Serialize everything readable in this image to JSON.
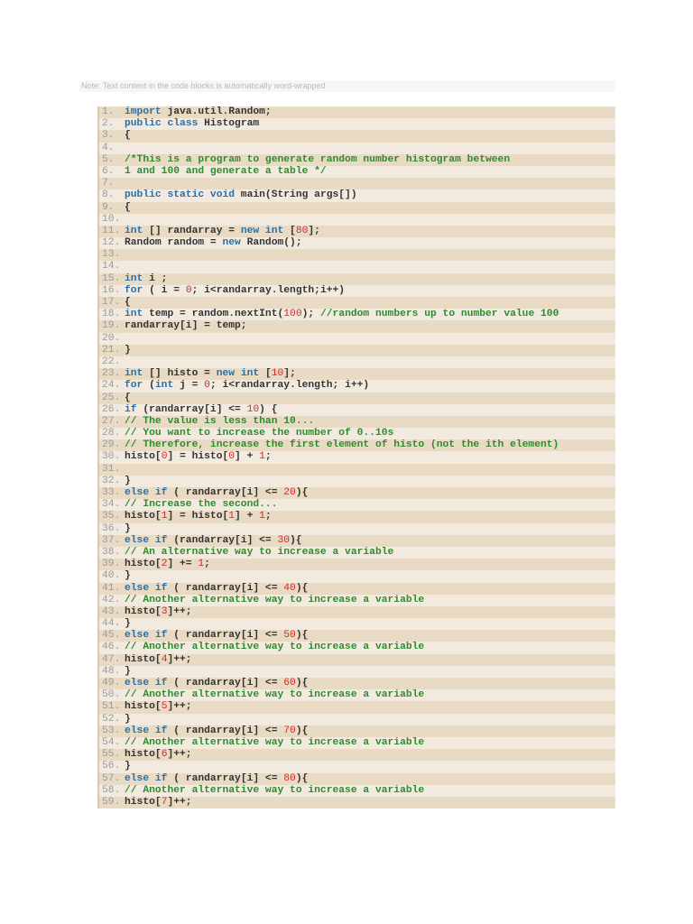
{
  "note": "Note: Text content in the code blocks is automatically word-wrapped",
  "colors": {
    "keyword": "#2a6fa8",
    "number": "#d42a2a",
    "comment": "#2e8b2e"
  },
  "lines": [
    [
      [
        "k",
        "import"
      ],
      [
        "t",
        " java.util.Random;"
      ]
    ],
    [
      [
        "k",
        "public class"
      ],
      [
        "t",
        " Histogram"
      ]
    ],
    [
      [
        "t",
        "{"
      ]
    ],
    [],
    [
      [
        "c",
        "/*This is a program to generate random number histogram between"
      ]
    ],
    [
      [
        "c",
        "1 and 100 and generate a table */"
      ]
    ],
    [],
    [
      [
        "k",
        "public static void"
      ],
      [
        "t",
        " main(String args[])"
      ]
    ],
    [
      [
        "t",
        "{"
      ]
    ],
    [],
    [
      [
        "k",
        "int"
      ],
      [
        "t",
        " [] randarray = "
      ],
      [
        "k",
        "new int"
      ],
      [
        "t",
        " ["
      ],
      [
        "n",
        "80"
      ],
      [
        "t",
        "];"
      ]
    ],
    [
      [
        "t",
        "Random random = "
      ],
      [
        "k",
        "new"
      ],
      [
        "t",
        " Random();"
      ]
    ],
    [],
    [],
    [
      [
        "k",
        "int"
      ],
      [
        "t",
        " i ;"
      ]
    ],
    [
      [
        "k",
        "for"
      ],
      [
        "t",
        " ( i = "
      ],
      [
        "n",
        "0"
      ],
      [
        "t",
        "; i<randarray.length;i++)"
      ]
    ],
    [
      [
        "t",
        "{"
      ]
    ],
    [
      [
        "k",
        "int"
      ],
      [
        "t",
        " temp = random.nextInt("
      ],
      [
        "n",
        "100"
      ],
      [
        "t",
        "); "
      ],
      [
        "c",
        "//random numbers up to number value 100"
      ]
    ],
    [
      [
        "t",
        "randarray[i] = temp;"
      ]
    ],
    [],
    [
      [
        "t",
        "}"
      ]
    ],
    [],
    [
      [
        "k",
        "int"
      ],
      [
        "t",
        " [] histo = "
      ],
      [
        "k",
        "new int"
      ],
      [
        "t",
        " ["
      ],
      [
        "n",
        "10"
      ],
      [
        "t",
        "];"
      ]
    ],
    [
      [
        "k",
        "for"
      ],
      [
        "t",
        " ("
      ],
      [
        "k",
        "int"
      ],
      [
        "t",
        " j = "
      ],
      [
        "n",
        "0"
      ],
      [
        "t",
        "; i<randarray.length; i++)"
      ]
    ],
    [
      [
        "t",
        "{"
      ]
    ],
    [
      [
        "k",
        "if"
      ],
      [
        "t",
        " (randarray[i] <= "
      ],
      [
        "n",
        "10"
      ],
      [
        "t",
        ") {"
      ]
    ],
    [
      [
        "c",
        "// The value is less than 10..."
      ]
    ],
    [
      [
        "c",
        "// You want to increase the number of 0..10s"
      ]
    ],
    [
      [
        "c",
        "// Therefore, increase the first element of histo (not the ith element)"
      ]
    ],
    [
      [
        "t",
        "histo["
      ],
      [
        "n",
        "0"
      ],
      [
        "t",
        "] = histo["
      ],
      [
        "n",
        "0"
      ],
      [
        "t",
        "] + "
      ],
      [
        "n",
        "1"
      ],
      [
        "t",
        ";"
      ]
    ],
    [],
    [
      [
        "t",
        "}"
      ]
    ],
    [
      [
        "k",
        "else if"
      ],
      [
        "t",
        " ( randarray[i] <= "
      ],
      [
        "n",
        "20"
      ],
      [
        "t",
        "){"
      ]
    ],
    [
      [
        "c",
        "// Increase the second..."
      ]
    ],
    [
      [
        "t",
        "histo["
      ],
      [
        "n",
        "1"
      ],
      [
        "t",
        "] = histo["
      ],
      [
        "n",
        "1"
      ],
      [
        "t",
        "] + "
      ],
      [
        "n",
        "1"
      ],
      [
        "t",
        ";"
      ]
    ],
    [
      [
        "t",
        "}"
      ]
    ],
    [
      [
        "k",
        "else if"
      ],
      [
        "t",
        " (randarray[i] <= "
      ],
      [
        "n",
        "30"
      ],
      [
        "t",
        "){"
      ]
    ],
    [
      [
        "c",
        "// An alternative way to increase a variable"
      ]
    ],
    [
      [
        "t",
        "histo["
      ],
      [
        "n",
        "2"
      ],
      [
        "t",
        "] += "
      ],
      [
        "n",
        "1"
      ],
      [
        "t",
        ";"
      ]
    ],
    [
      [
        "t",
        "}"
      ]
    ],
    [
      [
        "k",
        "else if"
      ],
      [
        "t",
        " ( randarray[i] <= "
      ],
      [
        "n",
        "40"
      ],
      [
        "t",
        "){"
      ]
    ],
    [
      [
        "c",
        "// Another alternative way to increase a variable"
      ]
    ],
    [
      [
        "t",
        "histo["
      ],
      [
        "n",
        "3"
      ],
      [
        "t",
        "]++;"
      ]
    ],
    [
      [
        "t",
        "}"
      ]
    ],
    [
      [
        "k",
        "else if"
      ],
      [
        "t",
        " ( randarray[i] <= "
      ],
      [
        "n",
        "50"
      ],
      [
        "t",
        "){"
      ]
    ],
    [
      [
        "c",
        "// Another alternative way to increase a variable"
      ]
    ],
    [
      [
        "t",
        "histo["
      ],
      [
        "n",
        "4"
      ],
      [
        "t",
        "]++;"
      ]
    ],
    [
      [
        "t",
        "}"
      ]
    ],
    [
      [
        "k",
        "else if"
      ],
      [
        "t",
        " ( randarray[i] <= "
      ],
      [
        "n",
        "60"
      ],
      [
        "t",
        "){"
      ]
    ],
    [
      [
        "c",
        "// Another alternative way to increase a variable"
      ]
    ],
    [
      [
        "t",
        "histo["
      ],
      [
        "n",
        "5"
      ],
      [
        "t",
        "]++;"
      ]
    ],
    [
      [
        "t",
        "}"
      ]
    ],
    [
      [
        "k",
        "else if"
      ],
      [
        "t",
        " ( randarray[i] <= "
      ],
      [
        "n",
        "70"
      ],
      [
        "t",
        "){"
      ]
    ],
    [
      [
        "c",
        "// Another alternative way to increase a variable"
      ]
    ],
    [
      [
        "t",
        "histo["
      ],
      [
        "n",
        "6"
      ],
      [
        "t",
        "]++;"
      ]
    ],
    [
      [
        "t",
        "}"
      ]
    ],
    [
      [
        "k",
        "else if"
      ],
      [
        "t",
        " ( randarray[i] <= "
      ],
      [
        "n",
        "80"
      ],
      [
        "t",
        "){"
      ]
    ],
    [
      [
        "c",
        "// Another alternative way to increase a variable"
      ]
    ],
    [
      [
        "t",
        "histo["
      ],
      [
        "n",
        "7"
      ],
      [
        "t",
        "]++;"
      ]
    ]
  ]
}
